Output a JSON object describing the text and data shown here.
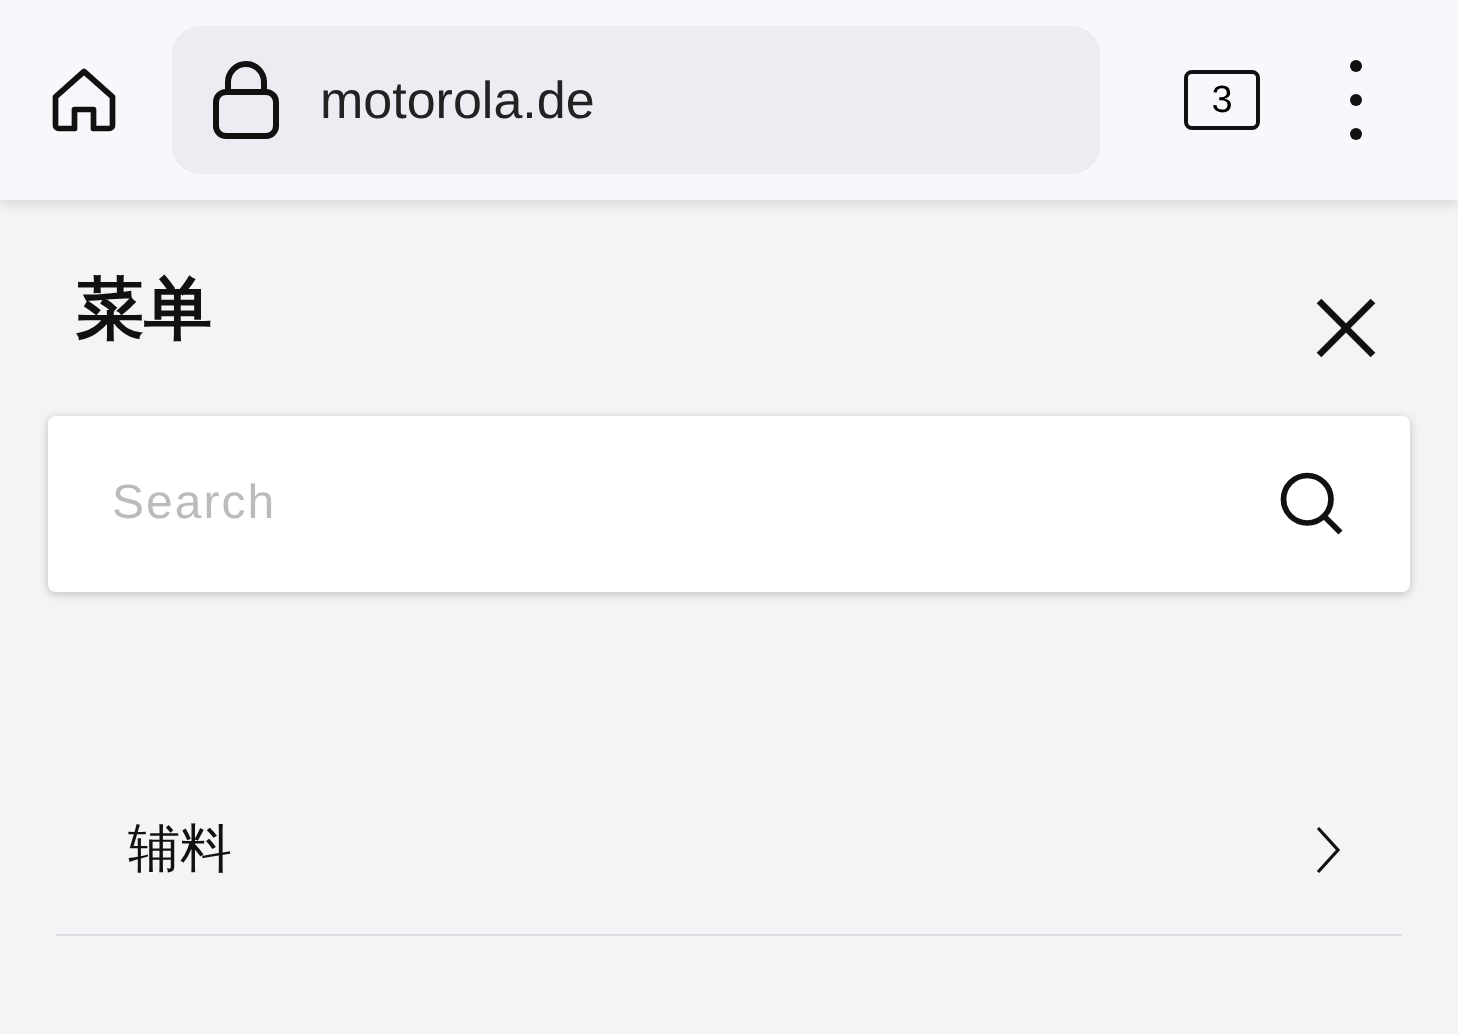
{
  "browser": {
    "url": "motorola.de",
    "tab_count": "3"
  },
  "menu": {
    "title": "菜单",
    "search": {
      "placeholder": "Search"
    },
    "items": [
      {
        "label": "辅料"
      }
    ]
  }
}
